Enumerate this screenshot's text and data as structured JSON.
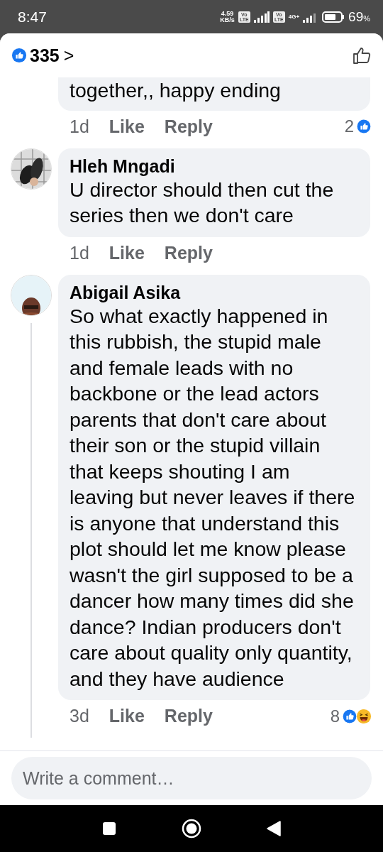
{
  "status_bar": {
    "time": "8:47",
    "speed": "4.59",
    "speed_unit": "KB/s",
    "volte": [
      "Vo LTE",
      "Vo LTE"
    ],
    "network": "4G+",
    "battery": "69",
    "battery_unit": "%"
  },
  "header": {
    "like_count": "335",
    "chevron": ">"
  },
  "comments": [
    {
      "kind": "partial",
      "text": "together,, happy ending",
      "time": "1d",
      "like": "Like",
      "reply": "Reply",
      "reaction_count": "2",
      "reactions": [
        {
          "kind": "like"
        }
      ]
    },
    {
      "kind": "full",
      "name": "Hleh Mngadi",
      "text": "U director should then cut the series then we don't care",
      "time": "1d",
      "like": "Like",
      "reply": "Reply",
      "thread": false
    },
    {
      "kind": "full",
      "name": "Abigail Asika",
      "text": "So what exactly happened in this rubbish, the stupid male and female leads with no backbone or the lead actors parents that don't care about their son or the stupid villain that keeps shouting I am leaving but never leaves if there is anyone that understand this plot should let me know please wasn't the girl supposed to be a dancer how many times did she dance? Indian producers don't care about quality  only quantity, and they have  audience",
      "time": "3d",
      "like": "Like",
      "reply": "Reply",
      "reaction_count": "8",
      "reactions": [
        {
          "kind": "like"
        },
        {
          "kind": "haha"
        }
      ],
      "thread": true
    }
  ],
  "composer": {
    "placeholder": "Write a comment…"
  }
}
